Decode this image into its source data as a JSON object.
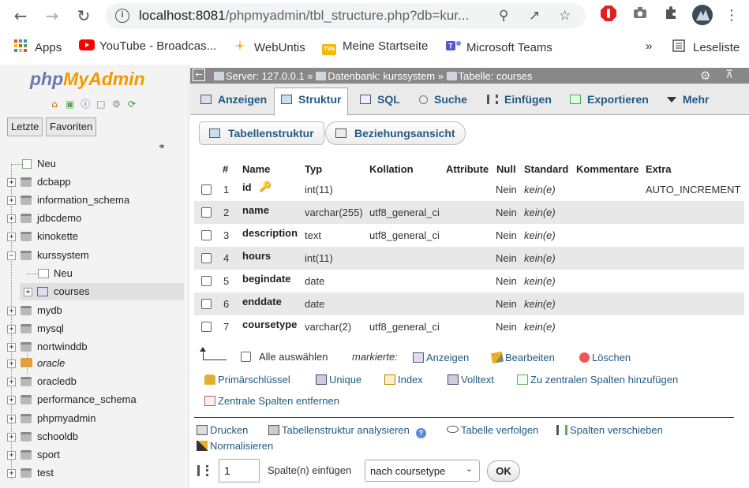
{
  "browser": {
    "url_host": "localhost:8081",
    "url_path": "/phpmyadmin/tbl_structure.php?db=kur...",
    "bookmarks": [
      "Apps",
      "YouTube - Broadcas...",
      "WebUntis",
      "Meine Startseite",
      "Microsoft Teams"
    ],
    "more": "»",
    "reading_list": "Leseliste"
  },
  "sidebar": {
    "logo_php": "php",
    "logo_myadmin": "MyAdmin",
    "tab_recent": "Letzte",
    "tab_favorites": "Favoriten",
    "tree": [
      {
        "label": "Neu"
      },
      {
        "label": "dcbapp"
      },
      {
        "label": "information_schema"
      },
      {
        "label": "jdbcdemo"
      },
      {
        "label": "kinokette"
      },
      {
        "label": "kurssystem"
      },
      {
        "label": "Neu"
      },
      {
        "label": "courses"
      },
      {
        "label": "mydb"
      },
      {
        "label": "mysql"
      },
      {
        "label": "nortwinddb"
      },
      {
        "label": "oracle"
      },
      {
        "label": "oracledb"
      },
      {
        "label": "performance_schema"
      },
      {
        "label": "phpmyadmin"
      },
      {
        "label": "schooldb"
      },
      {
        "label": "sport"
      },
      {
        "label": "test"
      }
    ]
  },
  "breadcrumb": {
    "server": "Server: 127.0.0.1",
    "sep1": "»",
    "database": "Datenbank: kurssystem",
    "sep2": "»",
    "table": "Tabelle: courses"
  },
  "tabs": [
    "Anzeigen",
    "Struktur",
    "SQL",
    "Suche",
    "Einfügen",
    "Exportieren",
    "Mehr"
  ],
  "subtabs": [
    "Tabellenstruktur",
    "Beziehungsansicht"
  ],
  "structure": {
    "headers": [
      "#",
      "Name",
      "Typ",
      "Kollation",
      "Attribute",
      "Null",
      "Standard",
      "Kommentare",
      "Extra"
    ],
    "rows": [
      {
        "num": "1",
        "name": "id",
        "type": "int(11)",
        "collation": "",
        "null": "Nein",
        "default": "kein(e)",
        "extra": "AUTO_INCREMENT"
      },
      {
        "num": "2",
        "name": "name",
        "type": "varchar(255)",
        "collation": "utf8_general_ci",
        "null": "Nein",
        "default": "kein(e)",
        "extra": ""
      },
      {
        "num": "3",
        "name": "description",
        "type": "text",
        "collation": "utf8_general_ci",
        "null": "Nein",
        "default": "kein(e)",
        "extra": ""
      },
      {
        "num": "4",
        "name": "hours",
        "type": "int(11)",
        "collation": "",
        "null": "Nein",
        "default": "kein(e)",
        "extra": ""
      },
      {
        "num": "5",
        "name": "begindate",
        "type": "date",
        "collation": "",
        "null": "Nein",
        "default": "kein(e)",
        "extra": ""
      },
      {
        "num": "6",
        "name": "enddate",
        "type": "date",
        "collation": "",
        "null": "Nein",
        "default": "kein(e)",
        "extra": ""
      },
      {
        "num": "7",
        "name": "coursetype",
        "type": "varchar(2)",
        "collation": "utf8_general_ci",
        "null": "Nein",
        "default": "kein(e)",
        "extra": ""
      }
    ]
  },
  "bulk": {
    "select_all": "Alle auswählen",
    "marked": "markierte:",
    "show": "Anzeigen",
    "edit": "Bearbeiten",
    "delete": "Löschen",
    "primary": "Primärschlüssel",
    "unique": "Unique",
    "index": "Index",
    "fulltext": "Volltext",
    "add_central": "Zu zentralen Spalten hinzufügen",
    "remove_central": "Zentrale Spalten entfernen"
  },
  "tools": {
    "print": "Drucken",
    "analyze": "Tabellenstruktur analysieren",
    "track": "Tabelle verfolgen",
    "move": "Spalten verschieben",
    "normalize": "Normalisieren"
  },
  "insert_columns": {
    "count": "1",
    "label": "Spalte(n) einfügen",
    "position": "nach coursetype",
    "ok": "OK"
  },
  "colors": {
    "link": "#235a81",
    "logo_php": "#6c78af",
    "logo_myadmin": "#f29a00",
    "topbar": "#888888"
  }
}
